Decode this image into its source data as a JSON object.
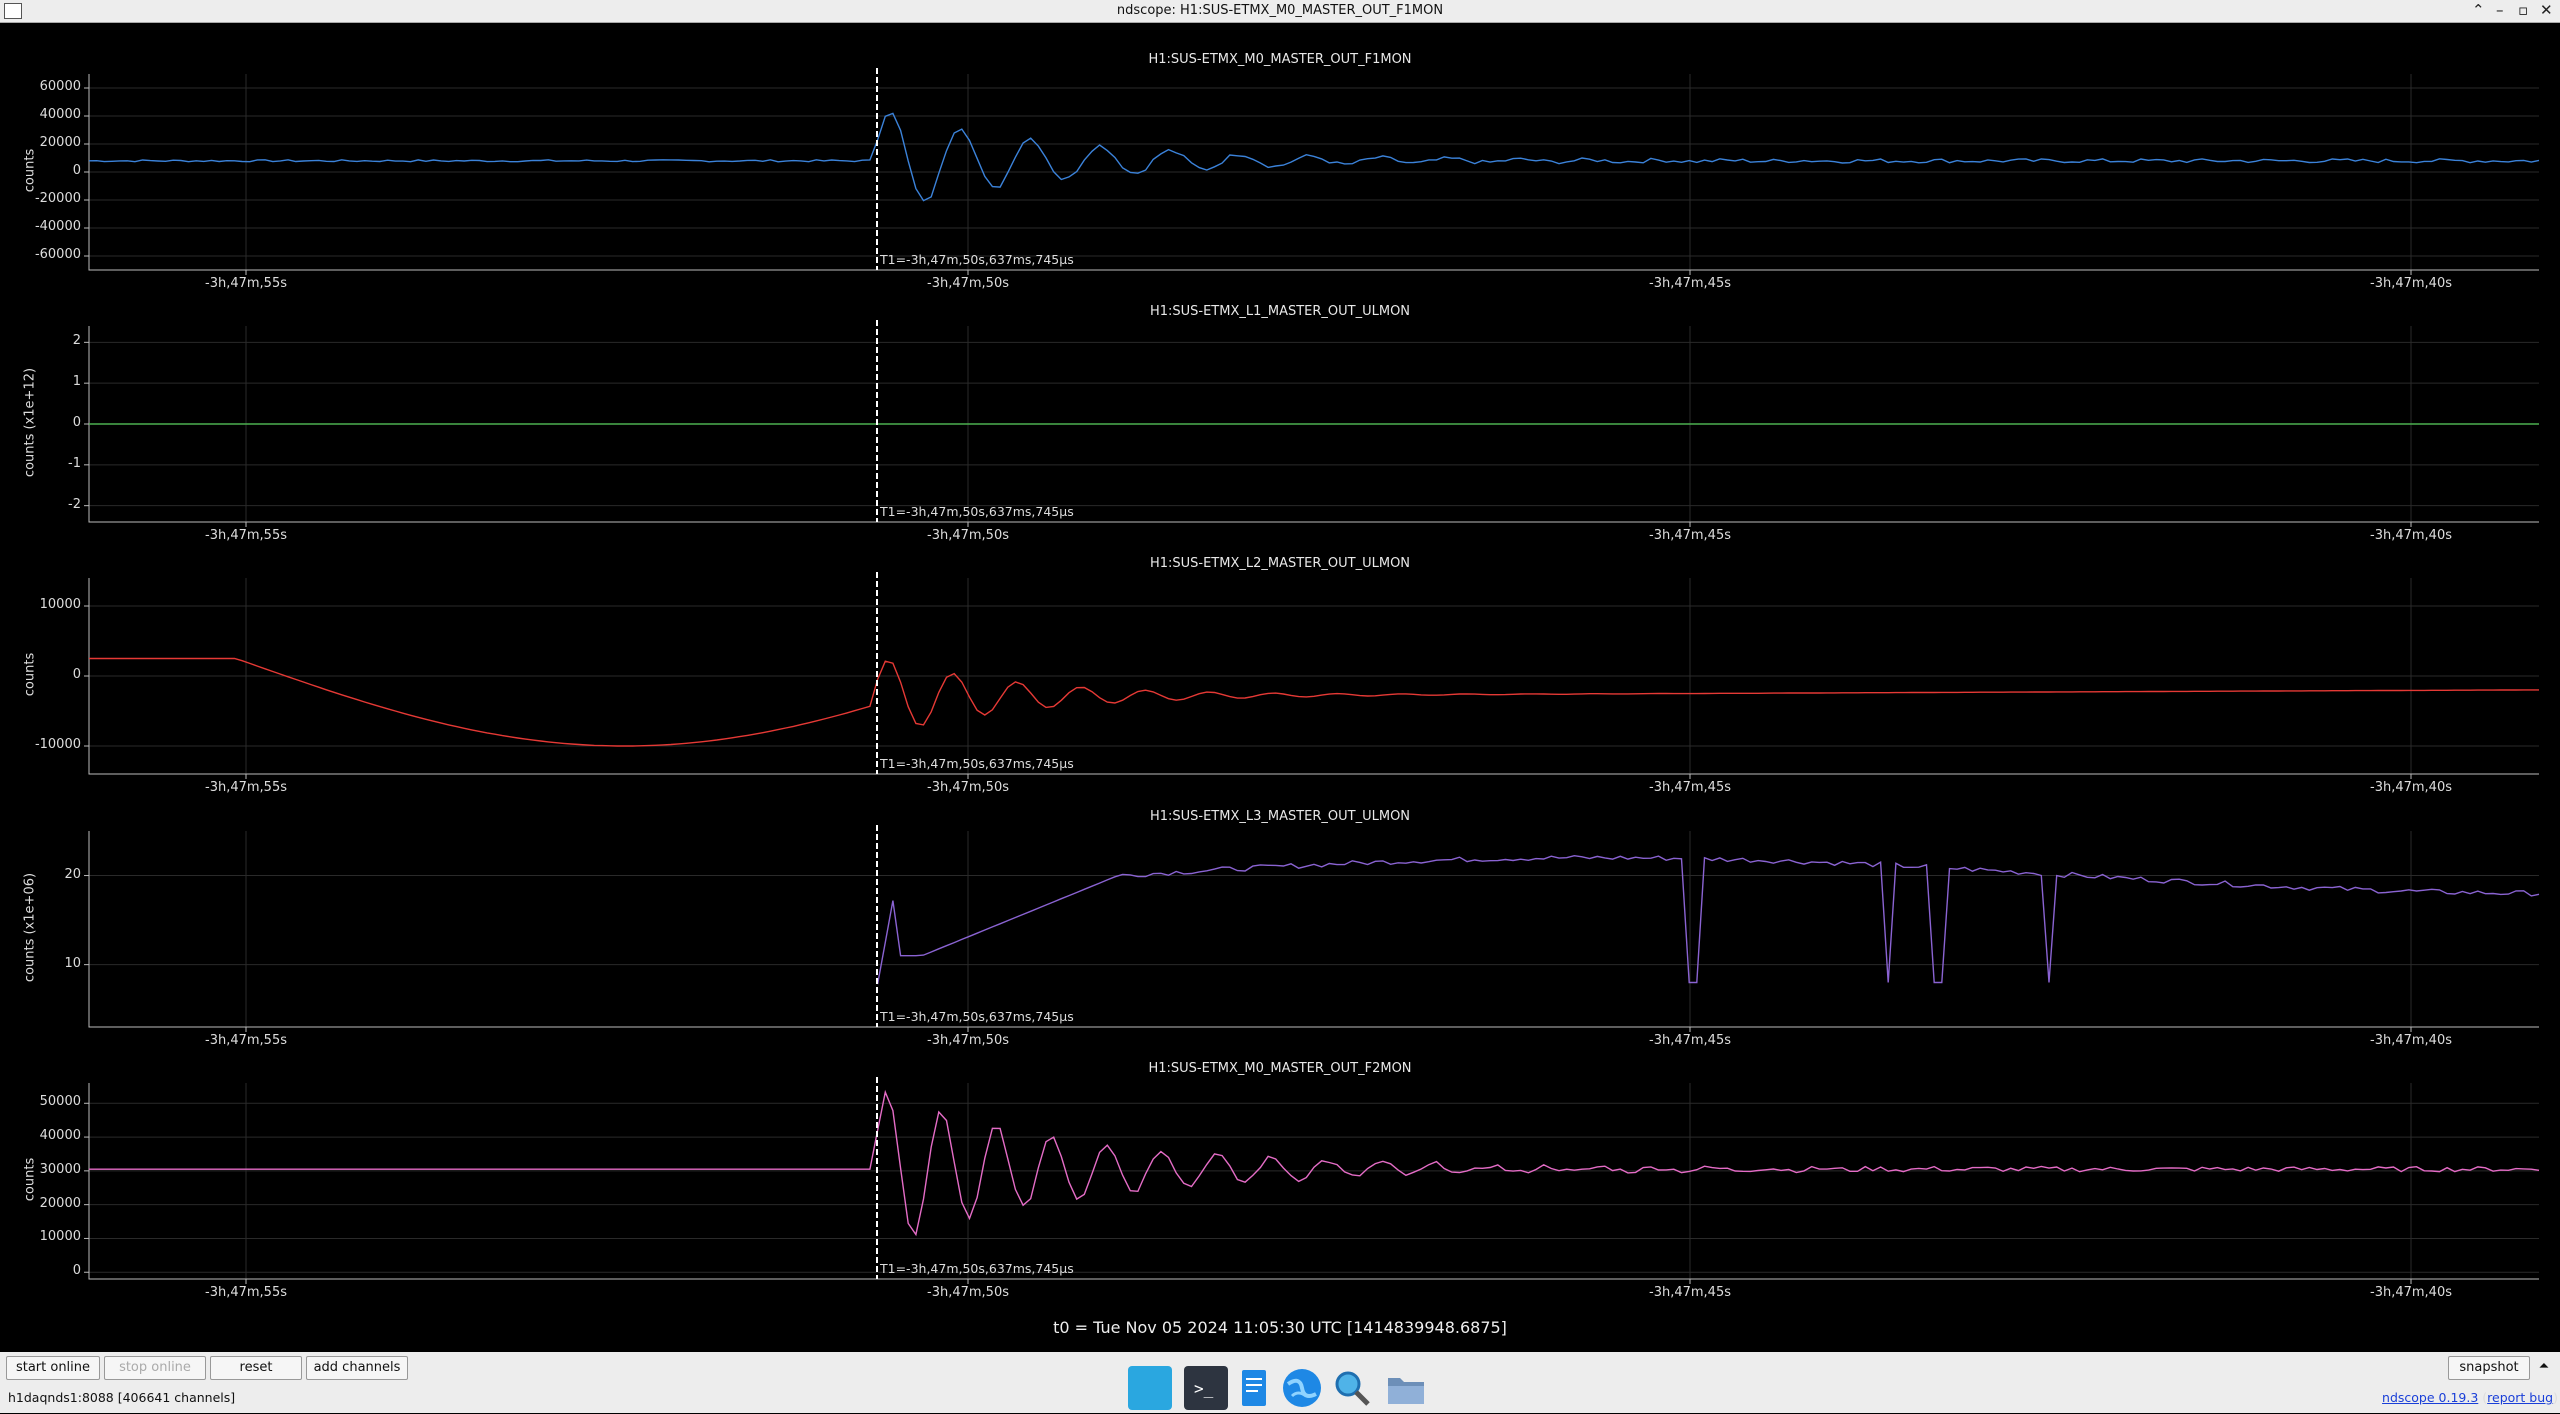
{
  "window": {
    "title": "ndscope: H1:SUS-ETMX_M0_MASTER_OUT_F1MON",
    "controls": [
      "⌃",
      "–",
      "▫",
      "✕"
    ]
  },
  "cursor_label": "T1=-3h,47m,50s,637ms,745μs",
  "x_ticks": [
    "-3h,47m,55s",
    "-3h,47m,50s",
    "-3h,47m,45s",
    "-3h,47m,40s"
  ],
  "plots": [
    {
      "title": "H1:SUS-ETMX_M0_MASTER_OUT_F1MON",
      "ylabel": "counts",
      "yticks": [
        "60000",
        "40000",
        "20000",
        "0",
        "-20000",
        "-40000",
        "-60000"
      ],
      "color": "#3b82d9"
    },
    {
      "title": "H1:SUS-ETMX_L1_MASTER_OUT_ULMON",
      "ylabel": "counts (x1e+12)",
      "yticks": [
        "2",
        "1",
        "0",
        "-1",
        "-2"
      ],
      "color": "#4caf50"
    },
    {
      "title": "H1:SUS-ETMX_L2_MASTER_OUT_ULMON",
      "ylabel": "counts",
      "yticks": [
        "10000",
        "0",
        "-10000"
      ],
      "color": "#e53935"
    },
    {
      "title": "H1:SUS-ETMX_L3_MASTER_OUT_ULMON",
      "ylabel": "counts (x1e+06)",
      "yticks": [
        "20",
        "10"
      ],
      "color": "#8a63d2"
    },
    {
      "title": "H1:SUS-ETMX_M0_MASTER_OUT_F2MON",
      "ylabel": "counts",
      "yticks": [
        "50000",
        "40000",
        "30000",
        "20000",
        "10000",
        "0"
      ],
      "color": "#e46cc6"
    }
  ],
  "t0_label": "t0 = Tue Nov 05 2024 11:05:30 UTC [1414839948.6875]",
  "toolbar": {
    "start_online": "start online",
    "stop_online": "stop online",
    "reset": "reset",
    "add_channels": "add channels",
    "snapshot": "snapshot",
    "menu_arrow": "⏶"
  },
  "status": "h1daqnds1:8088 [406641 channels]",
  "version": {
    "name": "ndscope 0.19.3",
    "report": "report bug"
  }
}
